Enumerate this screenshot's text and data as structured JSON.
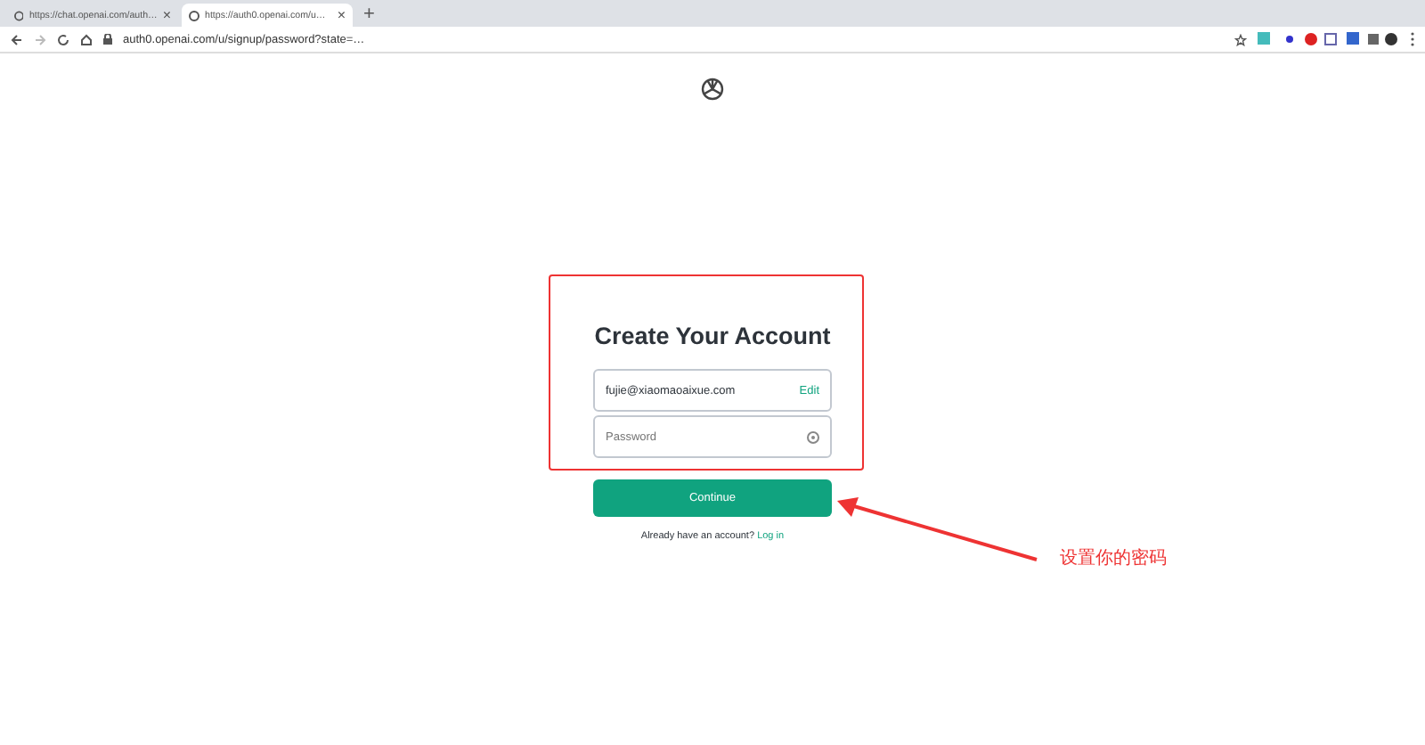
{
  "browser": {
    "tabs": [
      {
        "title": "https://chat.openai.com/auth…",
        "selected": false,
        "close": "×"
      },
      {
        "title": "https://auth0.openai.com/u…",
        "selected": true,
        "close": "×"
      }
    ],
    "new_tab": "+",
    "url": "auth0.openai.com/u/signup/password?state=…"
  },
  "form": {
    "title": "Create Your Account",
    "email": "fujie@xiaomaoaixue.com",
    "edit": "Edit",
    "password_placeholder": "Password",
    "continue": "Continue",
    "prompt": "Already have an account?",
    "login": "Log in"
  },
  "annotation": {
    "text": "设置你的密码"
  }
}
